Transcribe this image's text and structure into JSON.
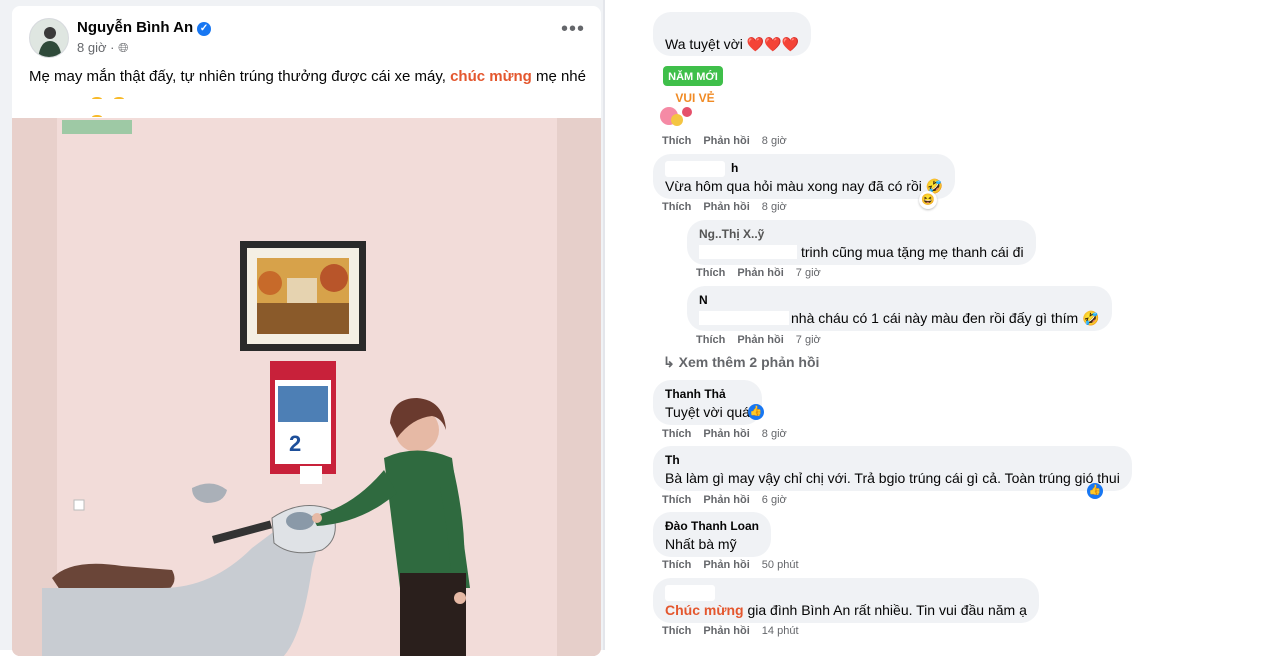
{
  "post": {
    "author": "Nguyễn Bình An",
    "time": "8 giờ",
    "caption_before": "Mẹ may mắn thật đấy, tự nhiên trúng thưởng được cái xe máy, ",
    "caption_highlight": "chúc mừng",
    "caption_after": " mẹ nhé",
    "calendar_day": "2"
  },
  "actions": {
    "like": "Thích",
    "reply": "Phản hồi"
  },
  "comments": [
    {
      "name": "",
      "text": "Wa tuyệt vời ❤️❤️❤️",
      "time": "8 giờ",
      "sticker_text": "NĂM MỚI VUI VẺ"
    },
    {
      "name": "h",
      "text": "Vừa hôm qua hỏi màu xong nay đã có rồi 🤣",
      "time": "8 giờ"
    },
    {
      "name": "Ng..Thị X..ỹ",
      "text": "trinh cũng mua tặng mẹ thanh cái đi",
      "time": "7 giờ"
    },
    {
      "name": "N",
      "text": "nhà cháu có 1 cái này màu đen rồi đấy gì thím 🤣",
      "time": "7 giờ"
    },
    {
      "name": "Thanh Thả",
      "text": "Tuyệt vời quá",
      "time": "8 giờ"
    },
    {
      "name": "Th",
      "text": "Bà làm gì may vậy chỉ chị với. Trả bgio trúng cái gì cả. Toàn trúng gió thui",
      "time": "6 giờ"
    },
    {
      "name": "Đào Thanh Loan",
      "text": "Nhất bà mỹ",
      "time": "50 phút"
    },
    {
      "name": "",
      "text_highlight": "Chúc mừng",
      "text": " gia đình Bình An rất nhiều. Tin vui đầu năm ạ",
      "time": "14 phút"
    }
  ],
  "more_replies": "Xem thêm 2 phản hồi"
}
